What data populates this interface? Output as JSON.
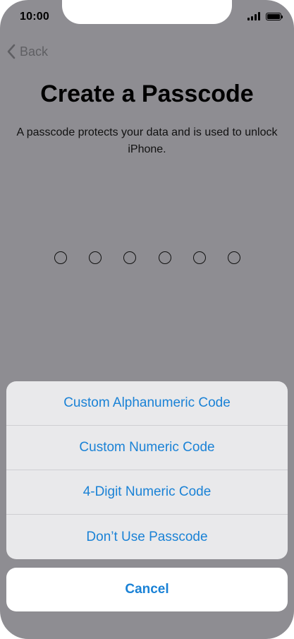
{
  "status_bar": {
    "time": "10:00",
    "signal_icon": "cellular-signal-icon",
    "battery_icon": "battery-icon"
  },
  "nav": {
    "back_label": "Back",
    "back_icon": "chevron-left-icon"
  },
  "page": {
    "title": "Create a Passcode",
    "subtitle": "A passcode protects your data and is used to unlock iPhone."
  },
  "passcode": {
    "entered": 0,
    "length": 6
  },
  "action_sheet": {
    "options": [
      "Custom Alphanumeric Code",
      "Custom Numeric Code",
      "4-Digit Numeric Code",
      "Don’t Use Passcode"
    ],
    "cancel_label": "Cancel"
  },
  "colors": {
    "accent": "#1a82d6",
    "dimmed_background": "#8e8d92",
    "sheet_background": "#e9e9eb"
  }
}
